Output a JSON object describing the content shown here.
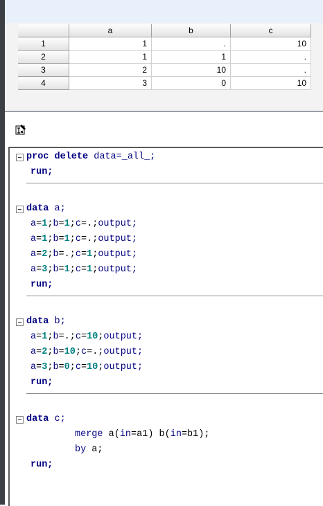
{
  "grid": {
    "columns": [
      "a",
      "b",
      "c"
    ],
    "rows": [
      {
        "n": "1",
        "a": "1",
        "b": ".",
        "c": "10"
      },
      {
        "n": "2",
        "a": "1",
        "b": "1",
        "c": "."
      },
      {
        "n": "3",
        "a": "2",
        "b": "10",
        "c": "."
      },
      {
        "n": "4",
        "a": "3",
        "b": "0",
        "c": "10"
      }
    ]
  },
  "highlight_color": "#f7f21a",
  "toolbar": {
    "icon": "edit-cursor-icon"
  },
  "code": {
    "b1": {
      "l1_kw": "proc delete",
      "l1_rest": " data=_all_;",
      "l2": "run;"
    },
    "b2": {
      "l1_kw": "data",
      "l1_rest": " a;",
      "rows": [
        {
          "a": "1",
          "b": "1",
          "c": "."
        },
        {
          "a": "1",
          "b": "1",
          "c": "."
        },
        {
          "a": "2",
          "b": ".",
          "c": "1"
        },
        {
          "a": "3",
          "b": "1",
          "c": "1"
        }
      ],
      "output": "output;",
      "run": "run;"
    },
    "b3": {
      "l1_kw": "data",
      "l1_rest": " b;",
      "rows": [
        {
          "a": "1",
          "b": ".",
          "c": "10"
        },
        {
          "a": "2",
          "b": "10",
          "c": "."
        },
        {
          "a": "3",
          "b": "0",
          "c": "10"
        }
      ],
      "output": "output;",
      "run": "run;"
    },
    "b4": {
      "l1_kw": "data",
      "l1_rest": " c;",
      "merge_kw": "merge",
      "merge_rest_1": " a(",
      "in_kw": "in",
      "merge_rest_2": "=a1) b(",
      "merge_rest_3": "=b1);",
      "by_kw": "by",
      "by_rest": " a;",
      "run": "run;"
    }
  }
}
